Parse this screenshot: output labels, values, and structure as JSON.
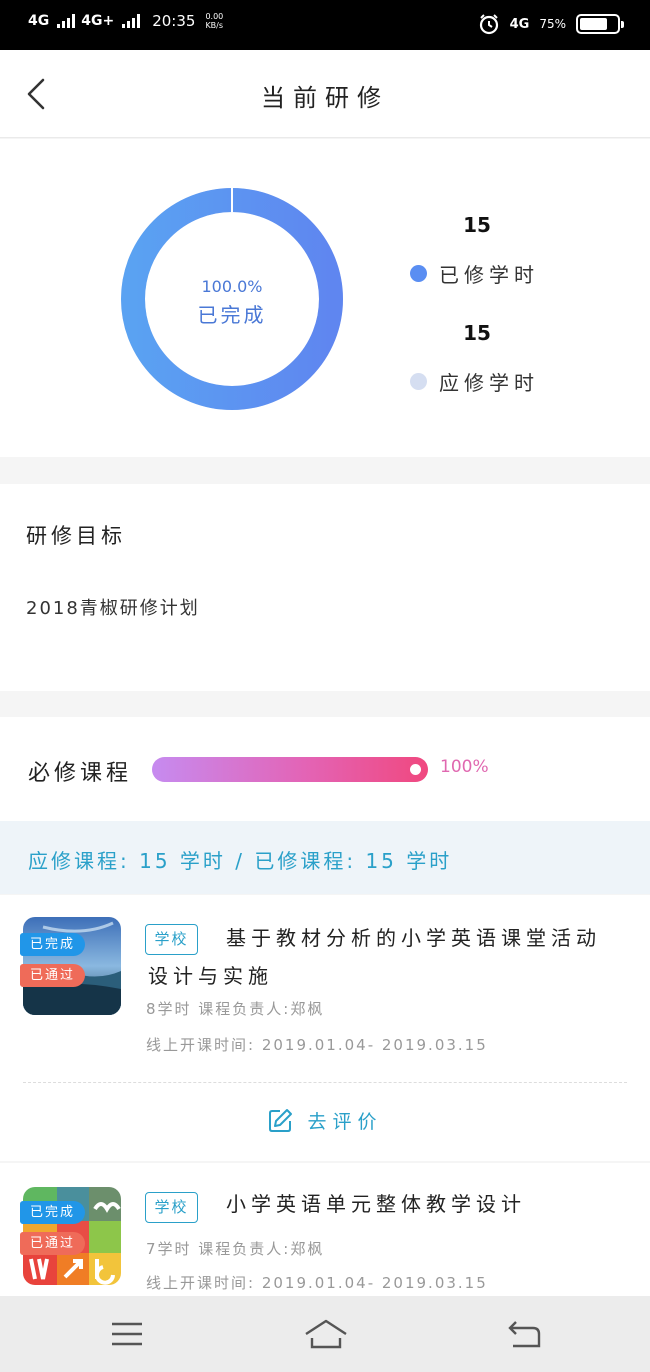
{
  "status_bar": {
    "net1": "4G",
    "net2": "4G+",
    "time": "20:35",
    "speed_value": "0.00",
    "speed_unit": "KB/s",
    "net_right": "4G",
    "battery_text": "75%",
    "battery_level": 0.75
  },
  "header": {
    "title": "当前研修"
  },
  "donut": {
    "percent_text": "100.0%",
    "status_text": "已完成",
    "progress": 1.0,
    "colors": {
      "from": "#5aa2f2",
      "to": "#5f86f0",
      "light": "#d5def1"
    }
  },
  "legend": [
    {
      "value": "15",
      "label": "已修学时",
      "color": "#5a8ef2"
    },
    {
      "value": "15",
      "label": "应修学时",
      "color": "#d5def1"
    }
  ],
  "goal": {
    "title": "研修目标",
    "text": "2018青椒研修计划"
  },
  "required": {
    "label": "必修课程",
    "percent_text": "100%",
    "progress": 1.0
  },
  "summary": {
    "text": "应修课程: 15 学时 / 已修课程: 15 学时"
  },
  "courses": [
    {
      "tag": "学校",
      "title": "基于教材分析的小学英语课堂活动设计与实施",
      "badge_done": "已完成",
      "badge_pass": "已通过",
      "hours_owner": "8学时  课程负责人:郑枫",
      "online_time": "线上开课时间: 2019.01.04- 2019.03.15",
      "eval_label": "去评价"
    },
    {
      "tag": "学校",
      "title": "小学英语单元整体教学设计",
      "badge_done": "已完成",
      "badge_pass": "已通过",
      "hours_owner": "7学时  课程负责人:郑枫",
      "online_time": "线上开课时间: 2019.01.04- 2019.03.15"
    }
  ]
}
